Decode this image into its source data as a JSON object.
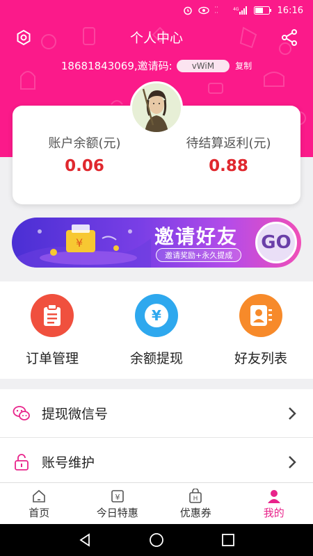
{
  "status_bar": {
    "time": "16:16",
    "network_label": "4G",
    "signal_label": "4G"
  },
  "header": {
    "title": "个人中心",
    "invite_text": "18681843069,邀请码:",
    "invite_code": "vWiM",
    "copy_label": "复制"
  },
  "balance": {
    "left_label": "账户余额(元)",
    "left_value": "0.06",
    "right_label": "待结算返利(元)",
    "right_value": "0.88"
  },
  "banner": {
    "title": "邀请好友",
    "subtitle": "邀请奖励+永久提成",
    "go_label": "GO"
  },
  "actions": [
    {
      "label": "订单管理",
      "icon": "clipboard-icon",
      "color": "#f0503e"
    },
    {
      "label": "余额提现",
      "icon": "yen-icon",
      "color": "#2ea8ee"
    },
    {
      "label": "好友列表",
      "icon": "contact-icon",
      "color": "#f78a2a"
    }
  ],
  "menu": [
    {
      "label": "提现微信号",
      "icon": "wechat-icon"
    },
    {
      "label": "账号维护",
      "icon": "lock-icon"
    }
  ],
  "tabs": [
    {
      "label": "首页",
      "icon": "home-icon",
      "active": false
    },
    {
      "label": "今日特惠",
      "icon": "yen-tag-icon",
      "active": false
    },
    {
      "label": "优惠券",
      "icon": "coupon-bag-icon",
      "active": false
    },
    {
      "label": "我的",
      "icon": "user-icon",
      "active": true
    }
  ],
  "colors": {
    "brand_pink": "#fb1a8a",
    "value_red": "#e0282e",
    "active_tab": "#e8238a"
  }
}
